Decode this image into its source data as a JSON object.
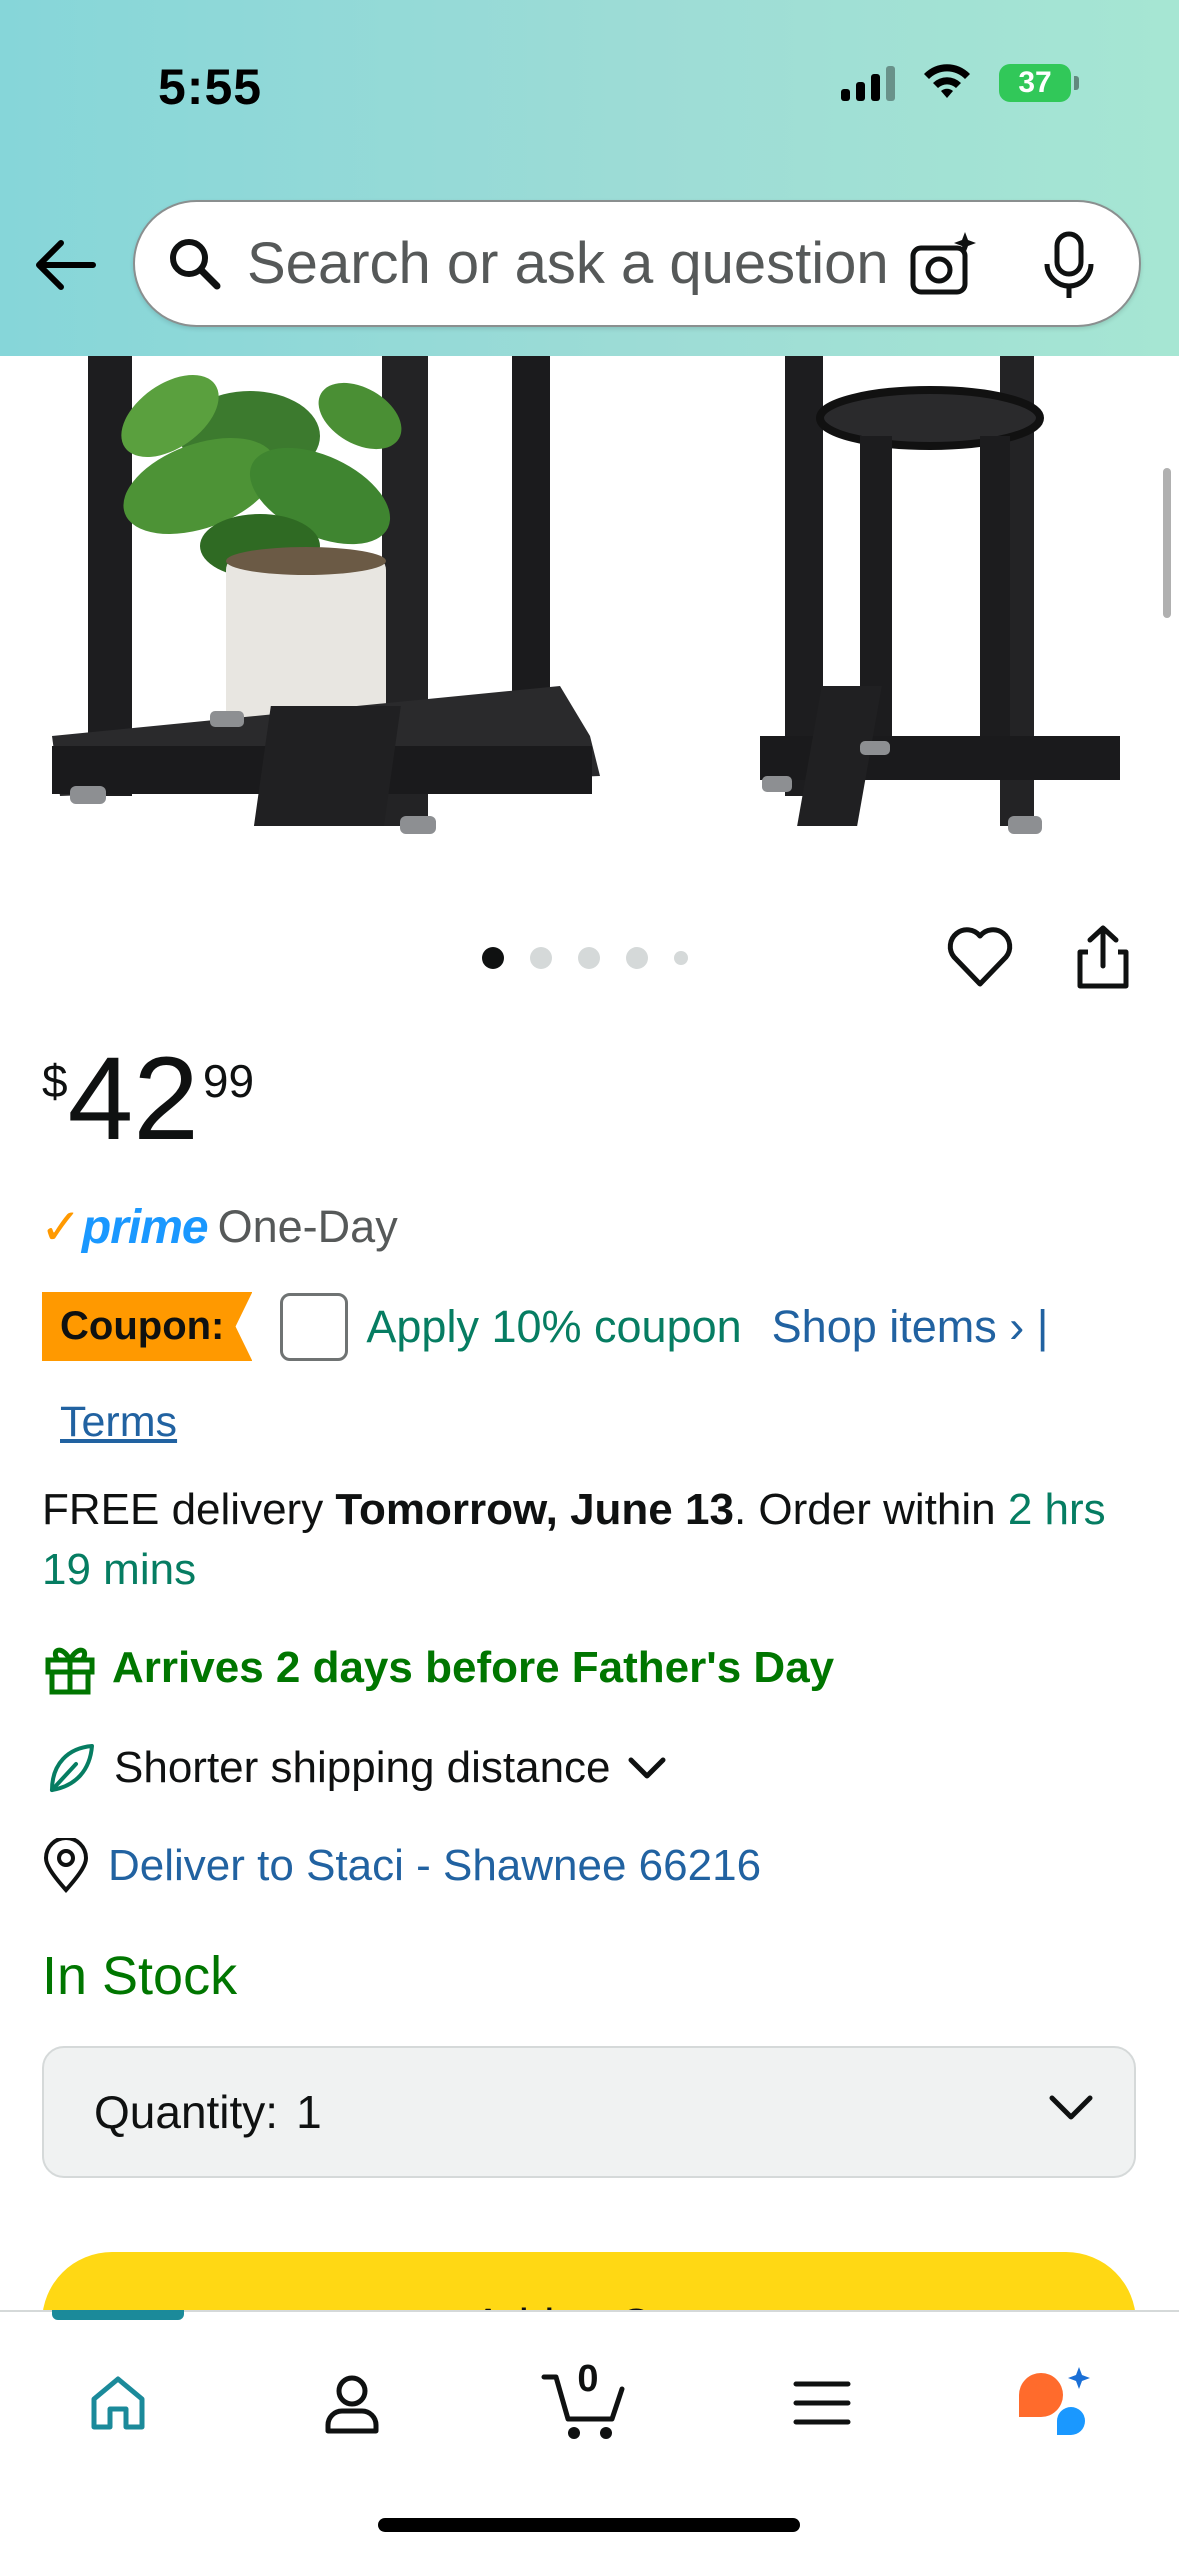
{
  "status_bar": {
    "time": "5:55",
    "battery": "37"
  },
  "search": {
    "placeholder": "Search or ask a question"
  },
  "carousel": {
    "dot_count": 5,
    "active_index": 0
  },
  "price": {
    "symbol": "$",
    "whole": "42",
    "fraction": "99"
  },
  "prime": {
    "check": "✓",
    "word": "prime",
    "speed": "One-Day"
  },
  "coupon": {
    "badge": "Coupon:",
    "apply": "Apply 10% coupon",
    "shop_items": "Shop items › |",
    "terms": "Terms"
  },
  "delivery": {
    "prefix": "FREE delivery ",
    "date": "Tomorrow, June 13",
    "middle": ". Order within ",
    "countdown": "2 hrs 19 mins"
  },
  "gift_note": "Arrives 2 days before Father's Day",
  "shipping_note": "Shorter shipping distance",
  "deliver_to": "Deliver to Staci - Shawnee 66216",
  "stock_status": "In Stock",
  "quantity": {
    "label": "Quantity:",
    "value": "1"
  },
  "add_to_cart": "Add to Cart",
  "bottom_nav": {
    "cart_count": "0"
  },
  "colors": {
    "header_gradient_start": "#86d6d9",
    "header_gradient_end": "#a6e6d3",
    "amazon_orange": "#ff9900",
    "prime_blue": "#1a98ff",
    "link_blue": "#2162a1",
    "deal_green": "#067d62",
    "stock_green": "#007600",
    "cart_yellow": "#ffd814"
  }
}
